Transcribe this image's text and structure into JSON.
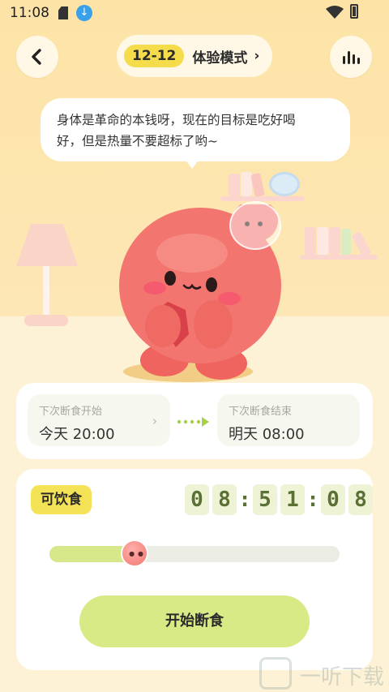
{
  "status_bar": {
    "time": "11:08"
  },
  "header": {
    "mode_badge": "12-12",
    "mode_label": "体验模式",
    "mode_chevron": "›"
  },
  "speech_bubble": {
    "line1": "身体是革命的本钱呀，现在的目标是吃好喝",
    "line2": "好，但是热量不要超标了哟~"
  },
  "schedule": {
    "start": {
      "caption": "下次断食开始",
      "value": "今天 20:00"
    },
    "end": {
      "caption": "下次断食结束",
      "value": "明天 08:00"
    }
  },
  "status": {
    "badge": "可饮食",
    "timer": {
      "h1": "0",
      "h2": "8",
      "m1": "5",
      "m2": "1",
      "s1": "0",
      "s2": "8"
    },
    "progress": 0.26
  },
  "actions": {
    "start_fasting": "开始断食"
  },
  "colors": {
    "accent_yellow": "#f5e357",
    "button_green": "#d8ea86",
    "mascot_pink": "#f2766f",
    "background": "#fde8b4"
  },
  "icons": {
    "back": "chevron-left-icon",
    "stats": "bar-chart-icon",
    "download": "download-icon",
    "wifi": "wifi-icon",
    "battery": "battery-icon"
  },
  "watermark": {
    "text": "一听下载"
  }
}
